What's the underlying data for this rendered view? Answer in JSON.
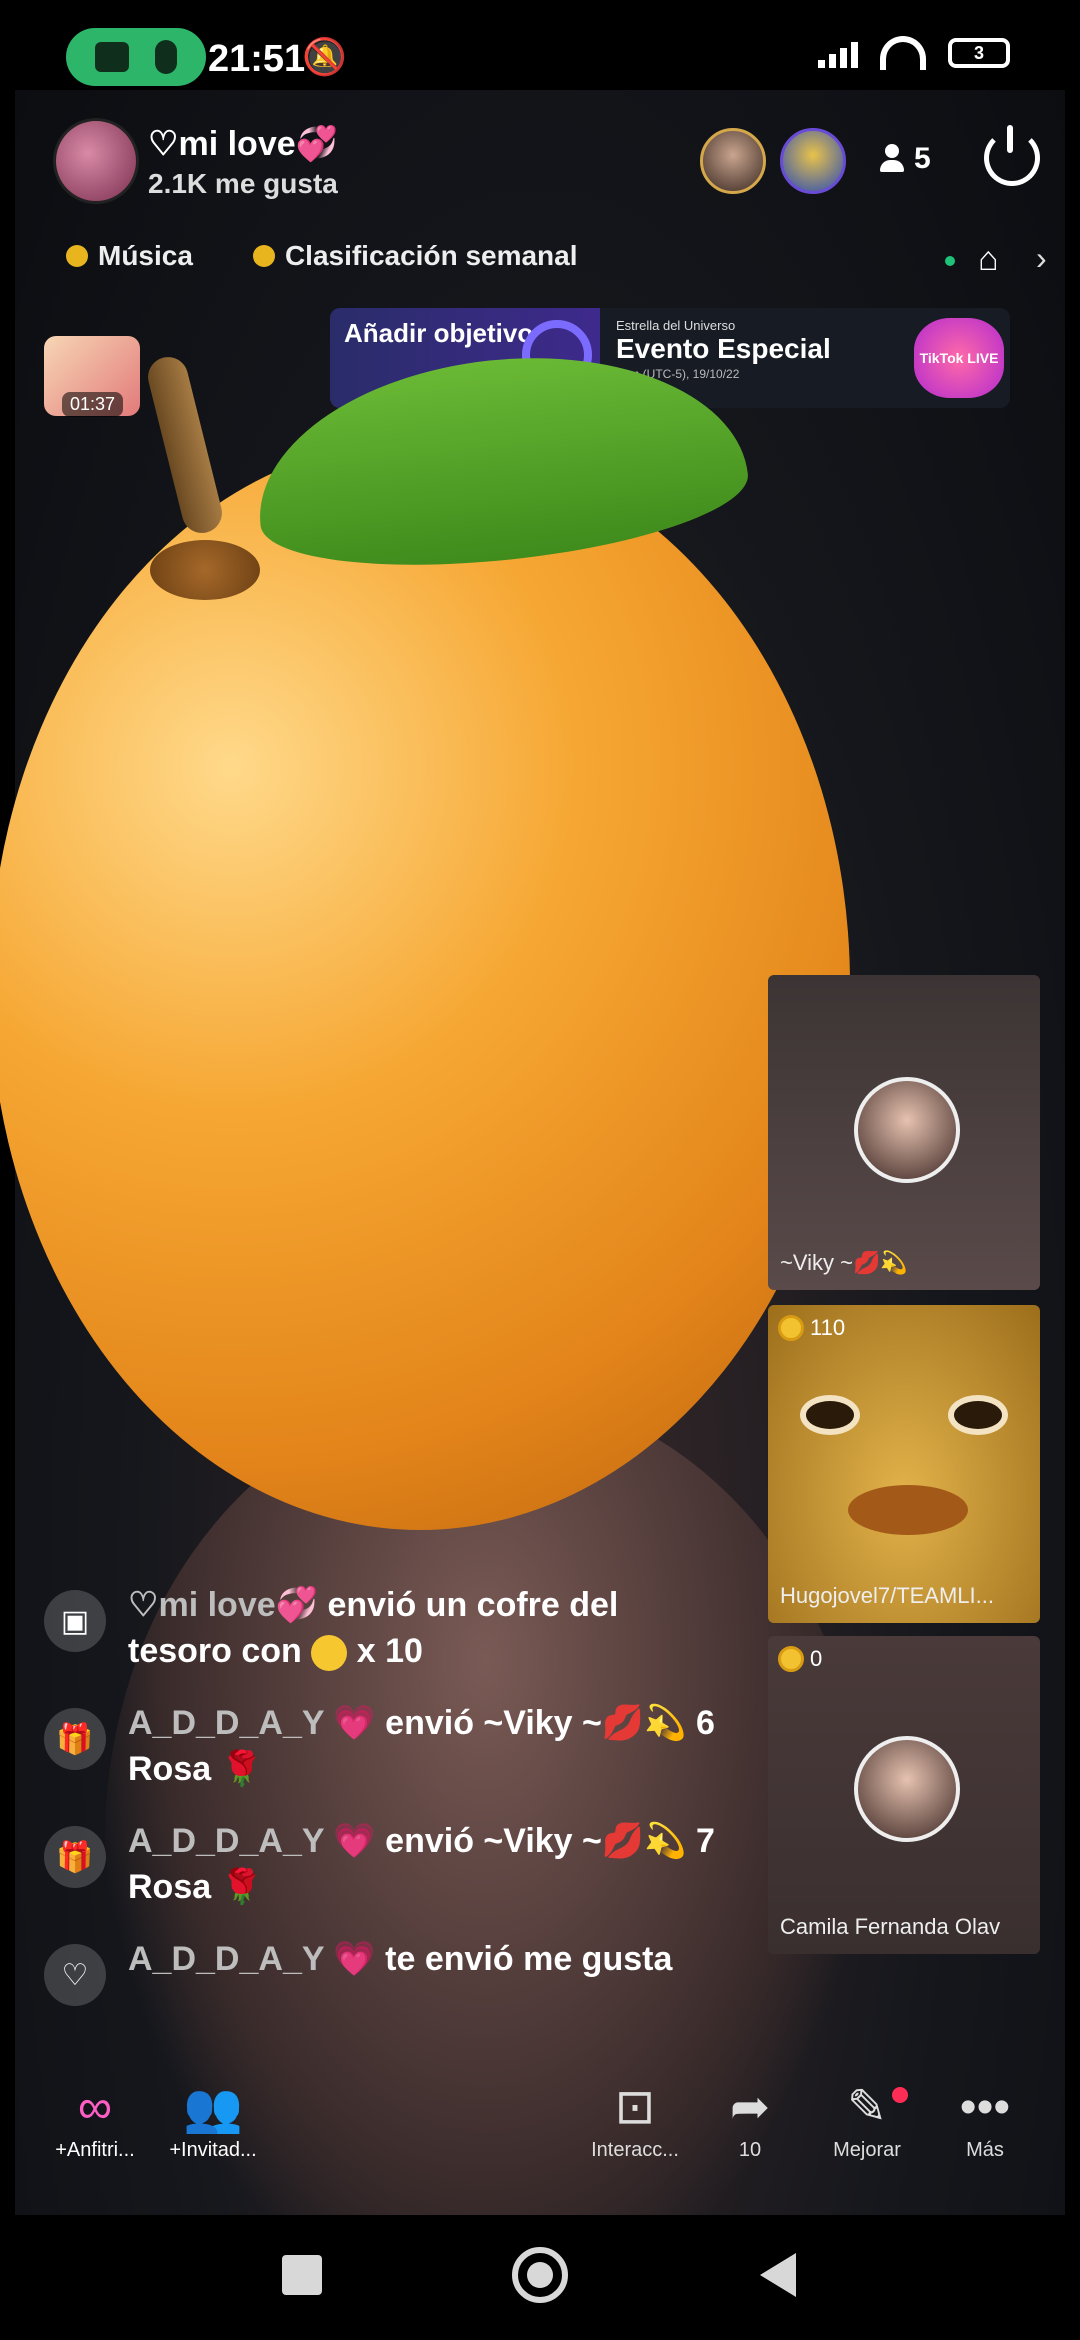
{
  "status": {
    "time": "21:51",
    "battery": "3"
  },
  "host": {
    "name": "♡mi love💞",
    "likes": "2.1K me gusta",
    "viewer_count": "5"
  },
  "chips": {
    "music": "Música",
    "ranking": "Clasificación semanal"
  },
  "banner": {
    "left_text": "Añadir objetivo",
    "small_title": "Estrella del Universo",
    "title": "Evento Especial",
    "subtitle": "8pm (UTC-5), 19/10/22",
    "badge": "TikTok LIVE"
  },
  "chest_timer": "01:37",
  "guests": [
    {
      "name": "~Viky ~💋💫",
      "score": ""
    },
    {
      "name": "Hugojovel7/TEAMLI...",
      "score": "110"
    },
    {
      "name": "Camila Fernanda Olav",
      "score": "0"
    }
  ],
  "comments": [
    {
      "user": "♡mi love💞",
      "text": "envió un cofre del tesoro con",
      "suffix": "x 10",
      "icon": "chest-icon"
    },
    {
      "user": "A_D_D_A_Y 💗",
      "text": "envió ~Viky ~💋💫 6 Rosa 🌹",
      "suffix": "",
      "icon": "gift-icon"
    },
    {
      "user": "A_D_D_A_Y 💗",
      "text": "envió ~Viky ~💋💫 7 Rosa 🌹",
      "suffix": "",
      "icon": "gift-icon"
    },
    {
      "user": "A_D_D_A_Y 💗",
      "text": "te envió me gusta",
      "suffix": "",
      "icon": "heart-icon"
    }
  ],
  "toolbar": {
    "anfitrion": "+Anfitri...",
    "invitados": "+Invitad...",
    "interacc": "Interacc...",
    "share_count": "10",
    "mejorar": "Mejorar",
    "mas": "Más"
  }
}
